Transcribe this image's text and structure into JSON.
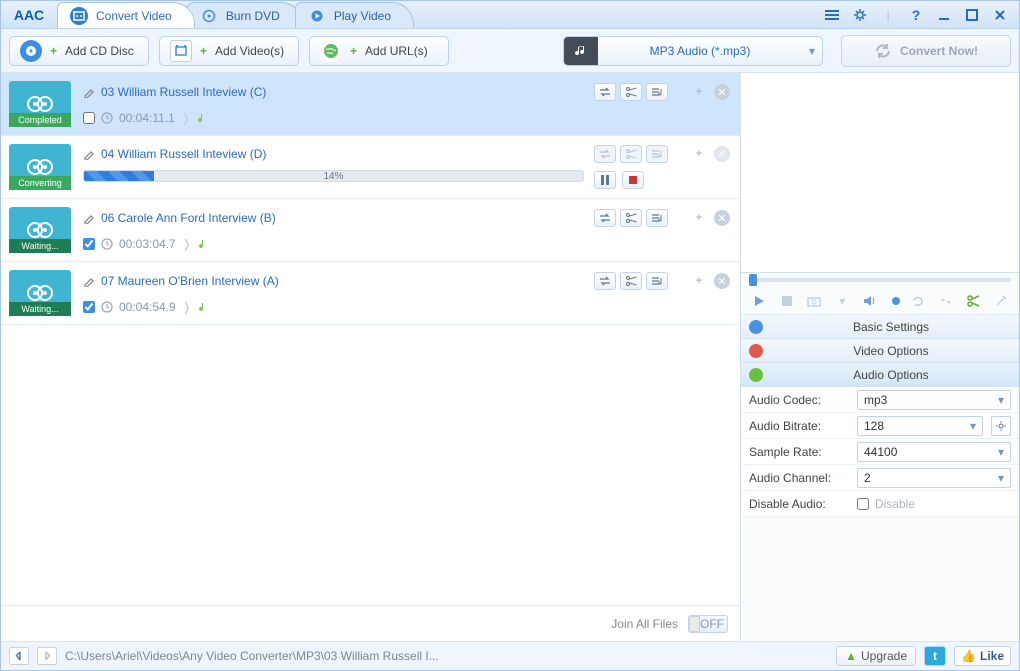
{
  "app": {
    "logo": "AAC"
  },
  "tabs": [
    {
      "label": "Convert Video",
      "active": true
    },
    {
      "label": "Burn DVD",
      "active": false
    },
    {
      "label": "Play Video",
      "active": false
    }
  ],
  "toolbar": {
    "add_cd": "Add CD Disc",
    "add_video": "Add Video(s)",
    "add_url": "Add URL(s)",
    "profile": "MP3 Audio (*.mp3)",
    "convert": "Convert Now!"
  },
  "items": [
    {
      "title": "03 William Russell Inteview (C)",
      "status": "Completed",
      "status_color": "#3aa85f",
      "duration": "00:04:11.1",
      "checked": false,
      "selected": true,
      "mode": "done"
    },
    {
      "title": "04 William Russell Inteview (D)",
      "status": "Converting",
      "status_color": "#3aa85f",
      "progress_pct": "14%",
      "selected": false,
      "mode": "progress"
    },
    {
      "title": "06 Carole Ann Ford Interview (B)",
      "status": "Waiting...",
      "status_color": "#1f7d54",
      "duration": "00:03:04.7",
      "checked": true,
      "selected": false,
      "mode": "done"
    },
    {
      "title": "07 Maureen O'Brien Interview (A)",
      "status": "Waiting...",
      "status_color": "#1f7d54",
      "duration": "00:04:54.9",
      "checked": true,
      "selected": false,
      "mode": "done"
    }
  ],
  "join_label": "Join All Files",
  "join_off": "OFF",
  "side": {
    "basic": "Basic Settings",
    "video": "Video Options",
    "audio_h": "Audio Options",
    "audio_codec_l": "Audio Codec:",
    "audio_codec_v": "mp3",
    "audio_bitrate_l": "Audio Bitrate:",
    "audio_bitrate_v": "128",
    "sample_rate_l": "Sample Rate:",
    "sample_rate_v": "44100",
    "audio_channel_l": "Audio Channel:",
    "audio_channel_v": "2",
    "disable_audio_l": "Disable Audio:",
    "disable_audio_v": "Disable"
  },
  "status": {
    "path": "C:\\Users\\Ariel\\Videos\\Any Video Converter\\MP3\\03 William Russell I...",
    "upgrade": "Upgrade",
    "like": "Like"
  }
}
